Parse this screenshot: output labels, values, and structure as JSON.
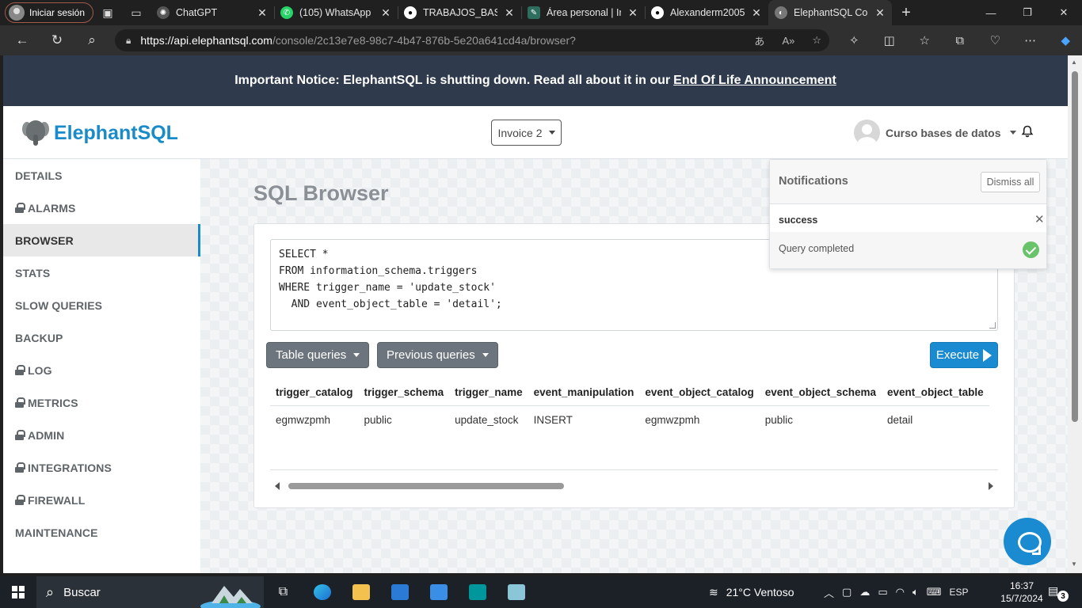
{
  "browser": {
    "profile_label": "Iniciar sesión",
    "tabs": [
      {
        "title": "ChatGPT",
        "icon": "chatgpt-icon"
      },
      {
        "title": "(105) WhatsApp",
        "icon": "whatsapp-icon"
      },
      {
        "title": "TRABAJOS_BASE",
        "icon": "github-icon"
      },
      {
        "title": "Área personal | In",
        "icon": "moodle-icon"
      },
      {
        "title": "Alexanderm2005",
        "icon": "github-icon"
      },
      {
        "title": "ElephantSQL Con",
        "icon": "elephant-icon"
      }
    ],
    "url_host": "https://api.elephantsql.com",
    "url_path": "/console/2c13e7e8-98c7-4b47-876b-5e20a641cd4a/browser?"
  },
  "notice": {
    "text": "Important Notice: ElephantSQL is shutting down. Read all about it in our",
    "link": "End Of Life Announcement"
  },
  "header": {
    "brand": "ElephantSQL",
    "instance": "Invoice 2",
    "user": "Curso bases de datos"
  },
  "sidebar": {
    "items": [
      {
        "label": "DETAILS",
        "locked": false
      },
      {
        "label": "ALARMS",
        "locked": true
      },
      {
        "label": "BROWSER",
        "locked": false,
        "active": true
      },
      {
        "label": "STATS",
        "locked": false
      },
      {
        "label": "SLOW QUERIES",
        "locked": false
      },
      {
        "label": "BACKUP",
        "locked": false
      },
      {
        "label": "LOG",
        "locked": true
      },
      {
        "label": "METRICS",
        "locked": true
      },
      {
        "label": "ADMIN",
        "locked": true
      },
      {
        "label": "INTEGRATIONS",
        "locked": true
      },
      {
        "label": "FIREWALL",
        "locked": true
      },
      {
        "label": "MAINTENANCE",
        "locked": false
      }
    ]
  },
  "main": {
    "title": "SQL Browser",
    "query": "SELECT *\nFROM information_schema.triggers\nWHERE trigger_name = 'update_stock'\n  AND event_object_table = 'detail';",
    "table_queries_label": "Table queries",
    "previous_queries_label": "Previous queries",
    "execute_label": "Execute",
    "results": {
      "columns": [
        "trigger_catalog",
        "trigger_schema",
        "trigger_name",
        "event_manipulation",
        "event_object_catalog",
        "event_object_schema",
        "event_object_table"
      ],
      "rows": [
        [
          "egmwzpmh",
          "public",
          "update_stock",
          "INSERT",
          "egmwzpmh",
          "public",
          "detail"
        ]
      ]
    }
  },
  "notifications": {
    "title": "Notifications",
    "dismiss_label": "Dismiss all",
    "type": "success",
    "message": "Query completed"
  },
  "taskbar": {
    "search_placeholder": "Buscar",
    "weather": "21°C  Ventoso",
    "language": "ESP",
    "time": "16:37",
    "date": "15/7/2024",
    "notification_count": "3"
  }
}
